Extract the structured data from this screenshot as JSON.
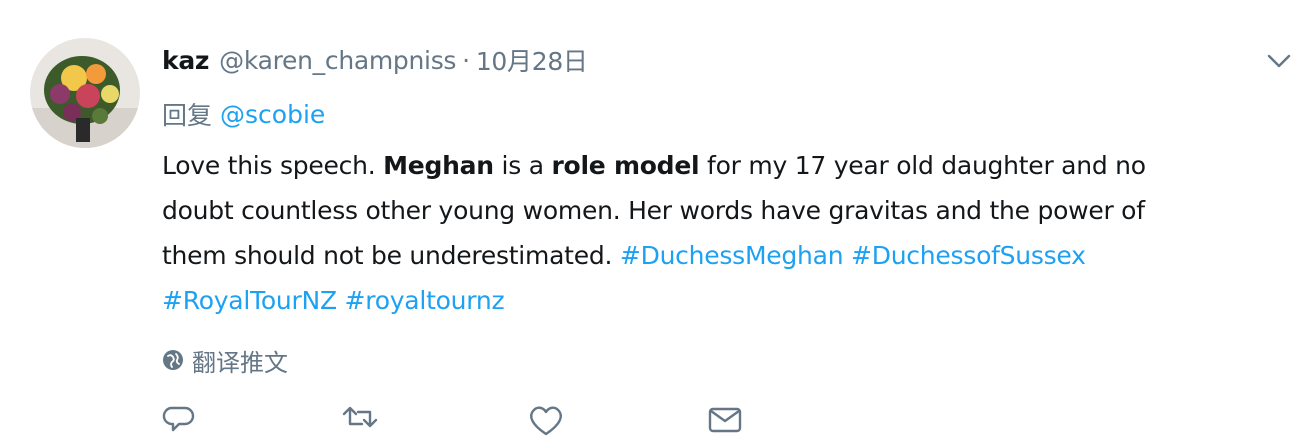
{
  "tweet": {
    "display_name": "kaz",
    "handle": "@karen_champniss",
    "separator": "·",
    "date": "10月28日",
    "reply_prefix": "回复",
    "reply_to": "@scobie",
    "body": {
      "l1_a": "Love this speech. ",
      "l1_b": "Meghan",
      "l1_c": " is a ",
      "l1_d": "role model",
      "l1_e": " for my 17 year old daughter and no",
      "l2": "doubt countless other young women. Her words have gravitas and the power of",
      "l3_a": "them should not be underestimated. ",
      "hashtags": [
        "#DuchessMeghan",
        "#DuchessofSussex",
        "#RoyalTourNZ",
        "#royaltournz"
      ]
    },
    "translate_label": "翻译推文",
    "icons": {
      "more": "chevron-down-icon",
      "translate": "globe-icon",
      "reply": "reply-icon",
      "retweet": "retweet-icon",
      "like": "heart-icon",
      "message": "direct-message-icon"
    },
    "colors": {
      "link": "#1da1f2",
      "secondary": "#657786",
      "text": "#14171a"
    }
  }
}
